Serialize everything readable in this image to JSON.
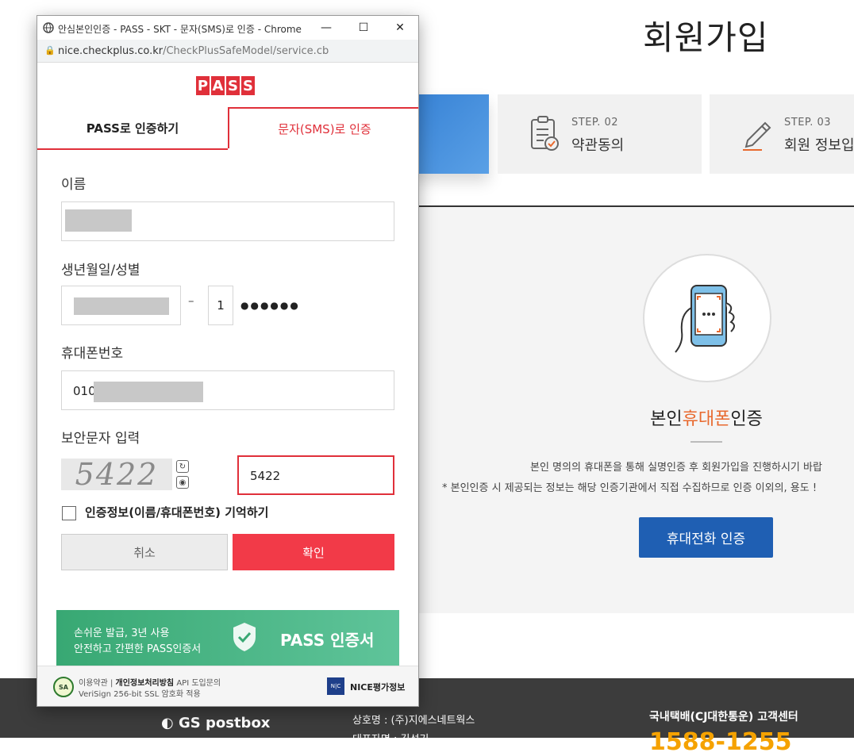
{
  "background_page": {
    "title": "회원가입",
    "steps": [
      {
        "kicker": "STEP. 02",
        "name": "약관동의"
      },
      {
        "kicker": "STEP. 03",
        "name": "회원 정보입"
      }
    ],
    "verify_title_pre": "본인",
    "verify_title_hl": "휴대폰",
    "verify_title_post": "인증",
    "desc_line1": "본인 명의의 휴대폰을 통해 실명인증 후 회원가입을 진행하시기 바랍",
    "desc_line2": "* 본인인증 시 제공되는 정보는 해당 인증기관에서 직접 수집하므로 인증 이외의, 용도 !",
    "phone_verify_button": "휴대전화 인증",
    "footer": {
      "logo": "GS postbox",
      "company_name": "상호명 : (주)지에스네트웍스",
      "representative": "대표자명 : 김석기",
      "cs_label": "국내택배(CJ대한통운) 고객센터",
      "cs_number": "1588-1255"
    }
  },
  "popup": {
    "window_title": "안심본인인증 - PASS - SKT - 문자(SMS)로 인증 - Chrome",
    "url_domain": "nice.checkplus.co.kr",
    "url_path": "/CheckPlusSafeModel/service.cb",
    "logo_letters": [
      "P",
      "A",
      "S",
      "S"
    ],
    "tabs": [
      {
        "label": "PASS로 인증하기"
      },
      {
        "label": "문자(SMS)로 인증"
      }
    ],
    "name_label": "이름",
    "birth_label": "생년월일/성별",
    "dash": "–",
    "gender_digit": "1",
    "masked": "●●●●●●",
    "phone_label": "휴대폰번호",
    "phone_prefix": "010",
    "captcha_label": "보안문자 입력",
    "captcha_image_text": "5422",
    "captcha_value": "5422",
    "remember_label": "인증정보(이름/휴대폰번호) 기억하기",
    "cancel_button": "취소",
    "confirm_button": "확인",
    "banner_line1": "손쉬운 발급, 3년 사용",
    "banner_line2": "안전하고 간편한 PASS인증서",
    "banner_brand": "PASS 인증서",
    "footer_links_pre": "이용약관 | ",
    "footer_link_privacy": "개인정보처리방침",
    "footer_links_post": " API 도입문의",
    "footer_ssl": "VeriSign 256-bit SSL 암호화 적용",
    "nice_brand": "NICE평가정보"
  }
}
